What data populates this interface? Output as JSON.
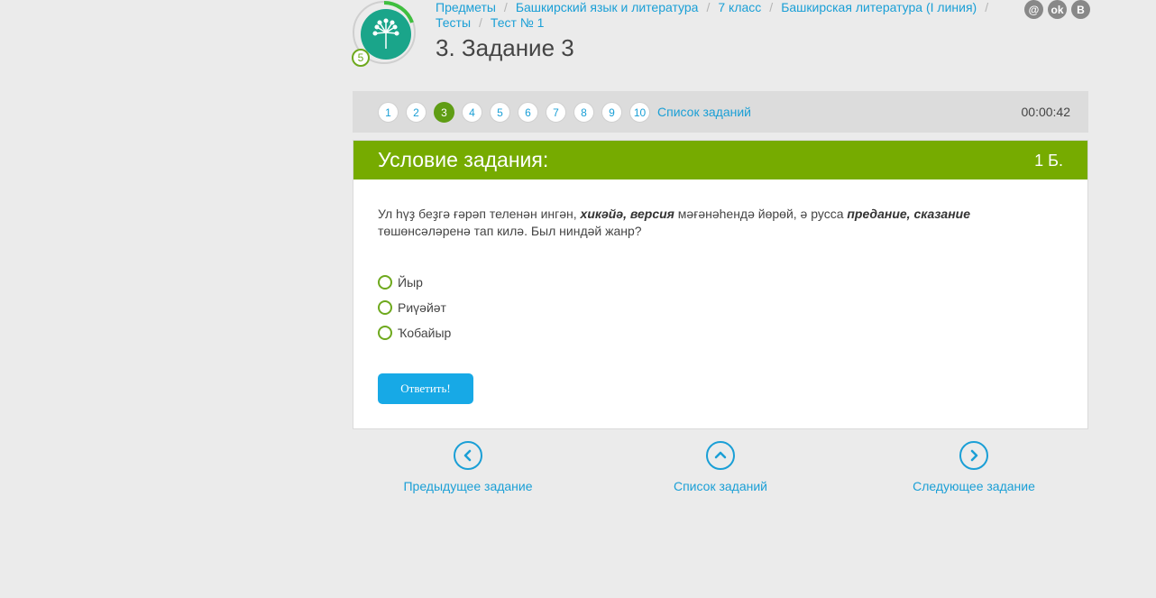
{
  "header": {
    "level_badge": "5",
    "breadcrumb": [
      "Предметы",
      "Башкирский язык и литература",
      "7 класс",
      "Башкирская литература (I линия)",
      "Тесты",
      "Тест № 1"
    ],
    "title": "3. Задание 3",
    "social": [
      "@",
      "ok",
      "B"
    ]
  },
  "task_bar": {
    "numbers": [
      "1",
      "2",
      "3",
      "4",
      "5",
      "6",
      "7",
      "8",
      "9",
      "10"
    ],
    "active": "3",
    "list_label": "Список заданий",
    "timer": "00:00:42"
  },
  "card": {
    "heading": "Условие задания:",
    "score": "1 Б.",
    "question_part1": "Ул һүҙ беҙгә ғәрәп теленән ингән, ",
    "question_bold1": "хикәйә, версия",
    "question_part2": " мәғәнәһендә йөрөй, ә русса ",
    "question_bold2": "предание, сказание",
    "question_part3": " төшөнсәләренә тап килә. Был ниндәй жанр?",
    "options": [
      "Йыр",
      "Риүәйәт",
      "Ҡобайыр"
    ],
    "answer_button": "Ответить!"
  },
  "bottom_nav": {
    "prev": "Предыдущее задание",
    "list": "Список заданий",
    "next": "Следующее задание"
  },
  "colors": {
    "accent_green": "#76ab00",
    "link_blue": "#1a9fd6",
    "button_blue": "#17a9e6",
    "logo_teal": "#1aa58a"
  }
}
